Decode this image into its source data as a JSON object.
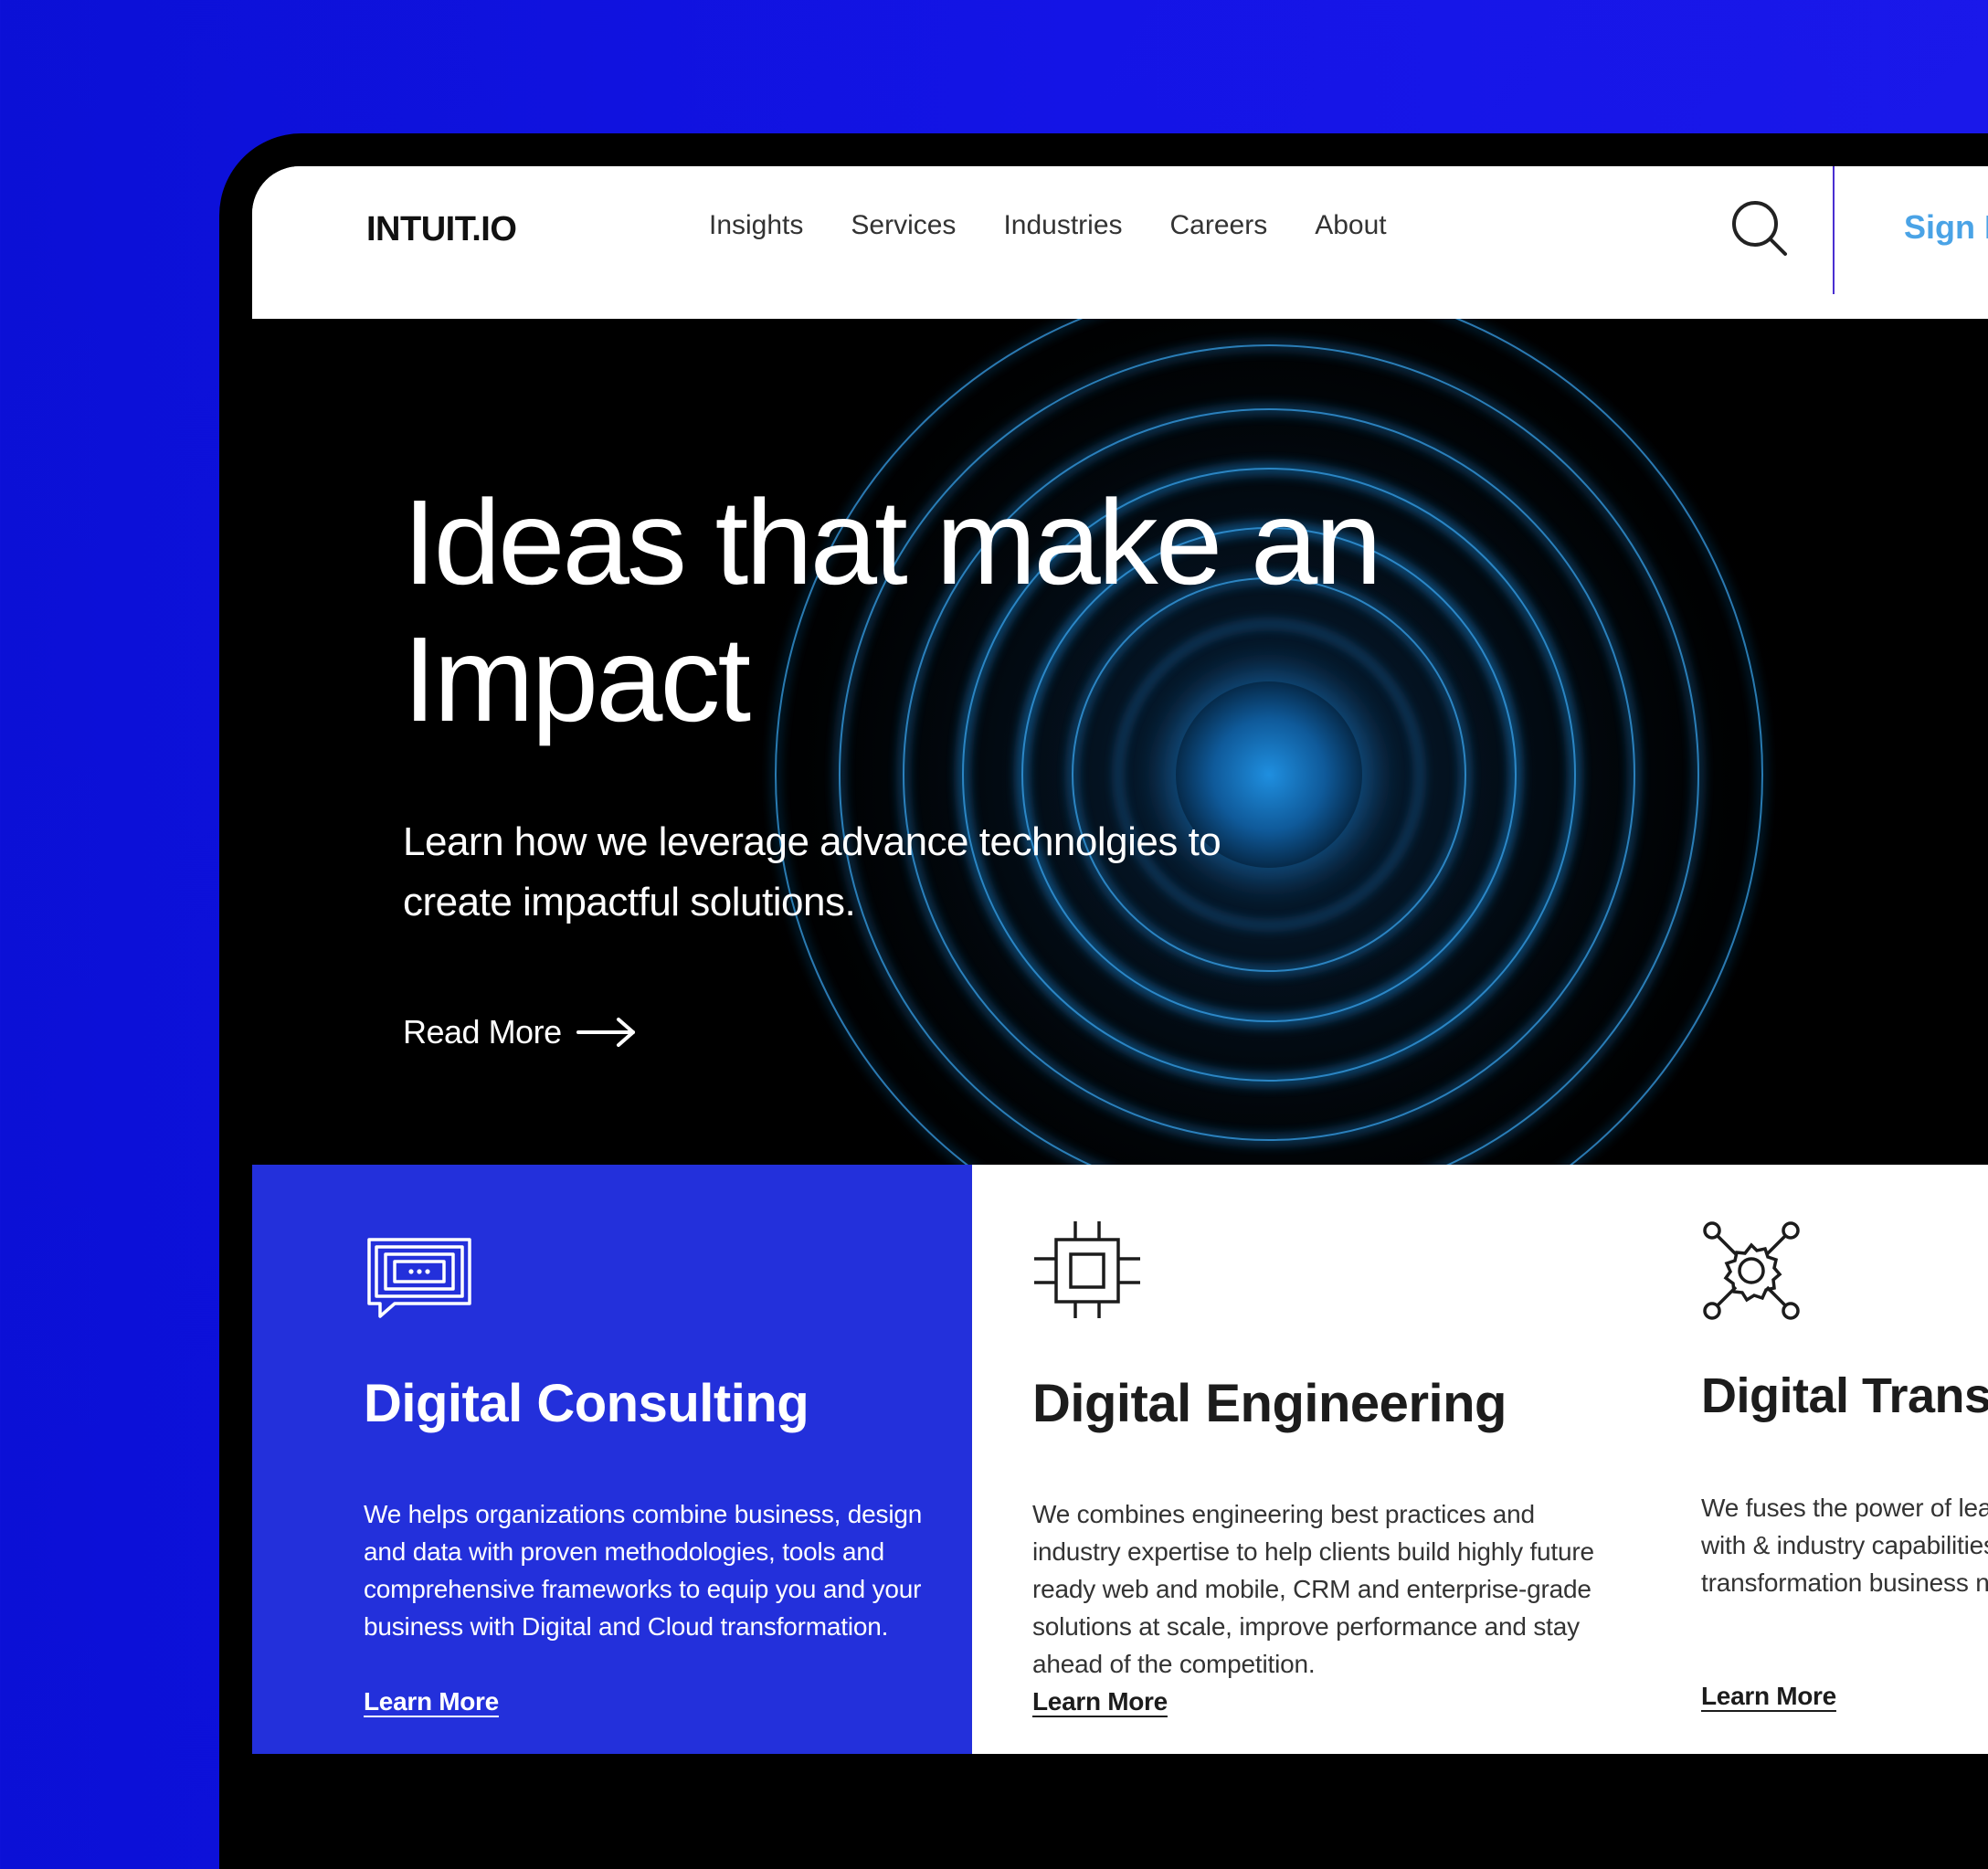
{
  "header": {
    "logo": "INTUIT.IO",
    "nav": [
      "Insights",
      "Services",
      "Industries",
      "Careers",
      "About"
    ],
    "search_icon": "search-icon",
    "sign_in": "Sign In"
  },
  "hero": {
    "title": "Ideas that make an Impact",
    "subtitle": "Learn how we  leverage advance technolgies to create impactful solutions.",
    "read_more": "Read More",
    "arrow_icon": "arrow-right-icon"
  },
  "cards": [
    {
      "icon": "chat-screens-icon",
      "title": "Digital Consulting",
      "body": "We helps organizations combine business, design and data with proven methodologies, tools and comprehensive frameworks to equip you and your business with Digital and Cloud transformation.",
      "link": "Learn More"
    },
    {
      "icon": "chip-icon",
      "title": "Digital Engineering",
      "body": "We combines engineering best practices and industry expertise to help clients build highly future ready web and mobile, CRM and enterprise-grade solutions at scale, improve performance and stay ahead of the competition.",
      "link": "Learn More"
    },
    {
      "icon": "gear-network-icon",
      "title": "Digital Transformation",
      "body": "We fuses the power of leading and cloud platforms— with & industry capabilities to drive platform-enabled transformation business needs to move with",
      "link": "Learn More"
    }
  ],
  "colors": {
    "page_background": "#1414e6",
    "accent_card": "#2330db",
    "sign_in": "#4aa3e6",
    "ring_glow": "#1e88d8"
  }
}
